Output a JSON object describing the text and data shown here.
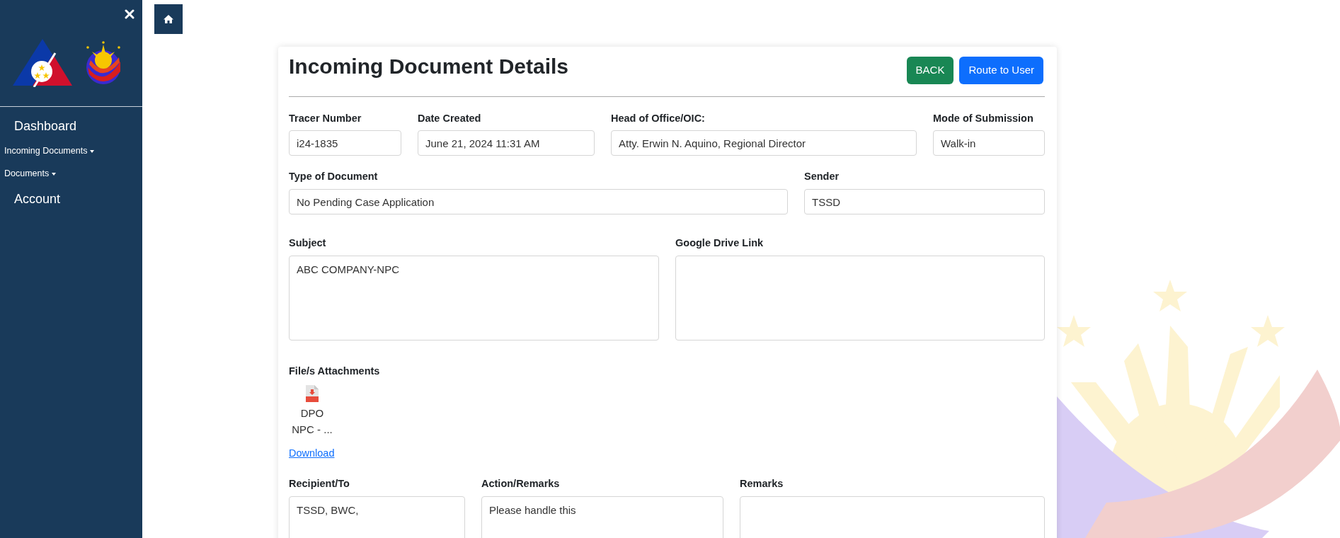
{
  "sidebar": {
    "items": [
      {
        "label": "Dashboard",
        "kind": "link"
      },
      {
        "label": "Incoming Documents",
        "kind": "dropdown"
      },
      {
        "label": "Documents",
        "kind": "dropdown"
      },
      {
        "label": "Account",
        "kind": "link"
      }
    ]
  },
  "page": {
    "title": "Incoming Document Details",
    "buttons": [
      {
        "label": "BACK",
        "kind": "success"
      },
      {
        "label": "Route to User",
        "kind": "primary"
      }
    ]
  },
  "detail_rows": [
    [
      {
        "label": "Tracer Number",
        "value": "i24-1835",
        "kind": "input"
      },
      {
        "label": "Date Created",
        "value": "June 21, 2024 11:31 AM",
        "kind": "input"
      },
      {
        "label": "Head of Office/OIC:",
        "value": "Atty. Erwin N. Aquino, Regional Director",
        "kind": "input"
      },
      {
        "label": "Mode of Submission",
        "value": "Walk-in",
        "kind": "input"
      }
    ],
    [
      {
        "label": "Type of Document",
        "value": "No Pending Case Application",
        "kind": "input"
      },
      {
        "label": "Sender",
        "value": "TSSD",
        "kind": "input"
      }
    ],
    [
      {
        "label": "Subject",
        "value": "ABC COMPANY-NPC",
        "kind": "textarea"
      },
      {
        "label": "Google Drive Link",
        "kind": "textarea"
      }
    ]
  ],
  "attachments": {
    "label": "File/s Attachments",
    "files": [
      {
        "name": "DPO NPC - ..."
      }
    ],
    "download": "Download"
  },
  "routing_row": [
    {
      "label": "Recipient/To",
      "value": "TSSD, BWC,",
      "kind": "textarea"
    },
    {
      "label": "Action/Remarks",
      "value": "Please handle this",
      "kind": "textarea"
    },
    {
      "label": "Remarks",
      "kind": "textarea"
    }
  ]
}
